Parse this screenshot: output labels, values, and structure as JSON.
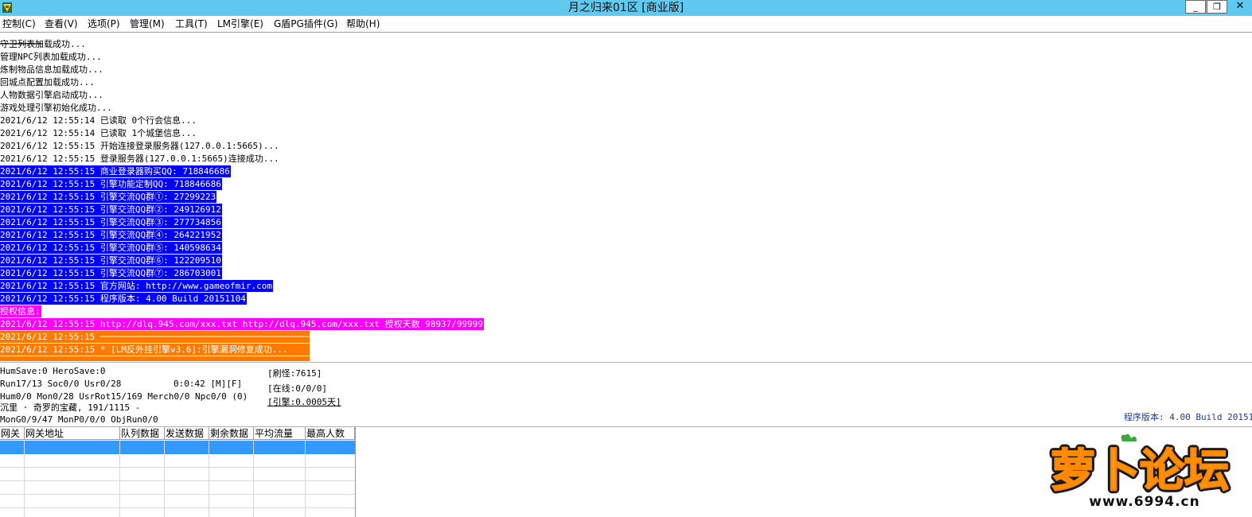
{
  "window": {
    "title": "月之归来01区 [商业版]",
    "minimize_glyph": "_",
    "maximize_glyph": "❐",
    "close_glyph": "✕"
  },
  "menu": [
    {
      "label": "控制(C)"
    },
    {
      "label": "查看(V)"
    },
    {
      "label": "选项(P)"
    },
    {
      "label": "管理(M)"
    },
    {
      "label": "工具(T)"
    },
    {
      "label": "LM引擎(E)"
    },
    {
      "label": "G盾PG插件(G)"
    },
    {
      "label": "帮助(H)"
    }
  ],
  "log": [
    {
      "text": "守卫列表加载成功...",
      "style": "plain"
    },
    {
      "text": "管理NPC列表加载成功...",
      "style": "plain"
    },
    {
      "text": "炼制物品信息加载成功...",
      "style": "plain"
    },
    {
      "text": "回城点配置加载成功...",
      "style": "plain"
    },
    {
      "text": "人物数据引擎启动成功...",
      "style": "plain"
    },
    {
      "text": "游戏处理引擎初始化成功...",
      "style": "plain"
    },
    {
      "text": "2021/6/12 12:55:14 已读取 0个行会信息...",
      "style": "plain"
    },
    {
      "text": "2021/6/12 12:55:14 已读取 1个城堡信息...",
      "style": "plain"
    },
    {
      "text": "2021/6/12 12:55:15 开始连接登录服务器(127.0.0.1:5665)...",
      "style": "plain"
    },
    {
      "text": "2021/6/12 12:55:15 登录服务器(127.0.0.1:5665)连接成功...",
      "style": "plain"
    },
    {
      "text": "2021/6/12 12:55:15 商业登录器购买QQ: 718846686",
      "style": "blue"
    },
    {
      "text": "2021/6/12 12:55:15 引擎功能定制QQ: 718846686",
      "style": "blue"
    },
    {
      "text": "2021/6/12 12:55:15 引擎交流QQ群①: 27299223",
      "style": "blue"
    },
    {
      "text": "2021/6/12 12:55:15 引擎交流QQ群②: 249126912",
      "style": "blue"
    },
    {
      "text": "2021/6/12 12:55:15 引擎交流QQ群③: 277734856",
      "style": "blue"
    },
    {
      "text": "2021/6/12 12:55:15 引擎交流QQ群④: 264221952",
      "style": "blue"
    },
    {
      "text": "2021/6/12 12:55:15 引擎交流QQ群⑤: 140598634",
      "style": "blue"
    },
    {
      "text": "2021/6/12 12:55:15 引擎交流QQ群⑥: 122209510",
      "style": "blue"
    },
    {
      "text": "2021/6/12 12:55:15 引擎交流QQ群⑦: 286703001",
      "style": "blue"
    },
    {
      "text": "2021/6/12 12:55:15 官方网站: http://www.gameofmir.com",
      "style": "blue"
    },
    {
      "text": "2021/6/12 12:55:15 程序版本: 4.00 Build 20151104",
      "style": "blue"
    },
    {
      "text": "授权信息:",
      "style": "magenta"
    },
    {
      "text": "2021/6/12 12:55:15 http://dlq.945.com/xxx.txt http://dlq.945.com/xxx.txt 授权天数 98937/99999",
      "style": "magenta"
    },
    {
      "text": "2021/6/12 12:55:15 ────────────────────────────────────────",
      "style": "orange"
    },
    {
      "text": "2021/6/12 12:55:15 * [LM反外挂引擎v3.6]:引擎漏洞修复成功...",
      "style": "orange"
    }
  ],
  "status": {
    "line1": "HumSave:0 HeroSave:0",
    "line2": "Run17/13 Soc0/0 Usr0/28",
    "timer": "0:0:42 [M][F]",
    "line3": "Hum0/0 Mon0/28 UsrRot15/169 Merch0/0 Npc0/0 (0)",
    "line4": "沉里 · 奇罗的宝藏, 191/1115 -",
    "line5": "MonG0/9/47 MonP0/0/0 ObjRun0/0",
    "refresh": "[刷怪:7615]",
    "online": "[在线:0/0/0]",
    "engine": "[引擎:0.0005天]",
    "version": "程序版本: 4.00 Build 20151"
  },
  "gateway_table": {
    "columns": [
      "网关",
      "网关地址",
      "队列数据",
      "发送数据",
      "剩余数据",
      "平均流量",
      "最高人数"
    ]
  },
  "watermark": {
    "brand": "萝卜论坛",
    "site": "www.6994.cn"
  },
  "colors": {
    "titlebar": "#5fc9ef",
    "highlight_blue": "#0000ff",
    "highlight_magenta": "#ff00ff",
    "highlight_orange": "#ff7a00",
    "table_selection": "#3399ff"
  }
}
